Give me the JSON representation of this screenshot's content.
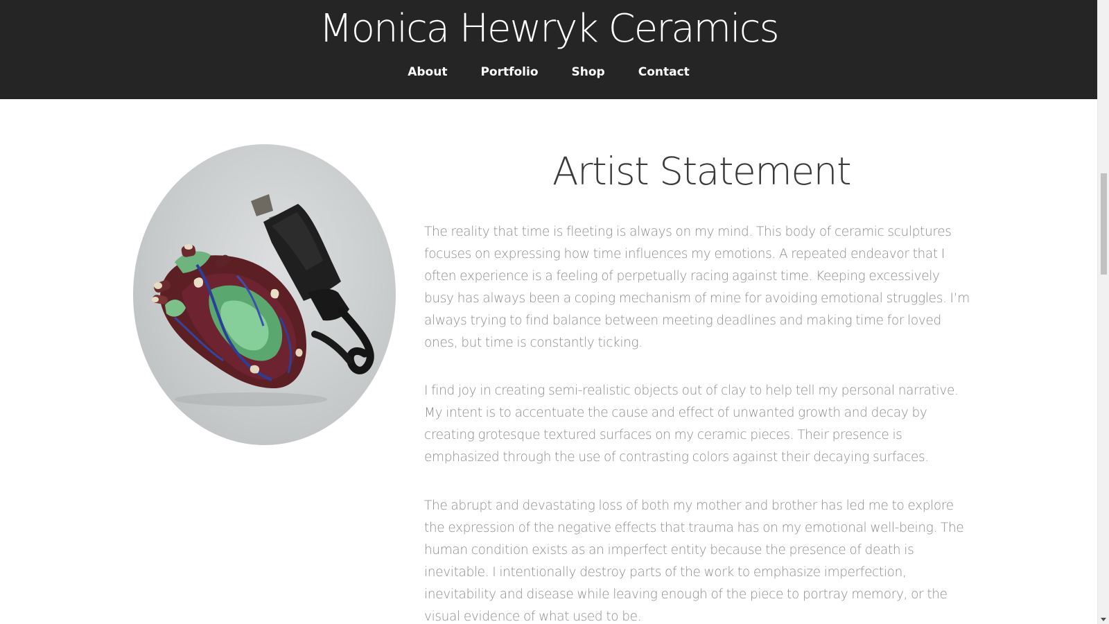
{
  "header": {
    "site_title": "Monica Hewryk Ceramics",
    "nav": [
      {
        "label": "About"
      },
      {
        "label": "Portfolio"
      },
      {
        "label": "Shop"
      },
      {
        "label": "Contact"
      }
    ]
  },
  "main": {
    "image_alt": "ceramic heart sculpture with electrical plug",
    "title": "Artist Statement",
    "paragraphs": [
      "The reality that time is fleeting is always on my mind. This body of ceramic sculptures focuses on expressing how time influences my emotions. A repeated endeavor that I often experience is a feeling of perpetually racing against time. Keeping excessively busy has always been a coping mechanism of mine for avoiding emotional struggles. I’m always trying to find balance between meeting deadlines and making time for loved ones, but time is constantly ticking.",
      "I find joy in creating semi-realistic objects out of clay to help tell my personal narrative. My intent is to accentuate the cause and effect of unwanted growth and decay by creating grotesque textured surfaces on my ceramic pieces. Their presence is emphasized through the use of contrasting colors against their decaying surfaces.",
      "The abrupt and devastating loss of both my mother and brother has led me to explore the expression of the negative effects that trauma has on my emotional well-being. The human condition exists as an imperfect entity because the presence of death is inevitable. I intentionally destroy parts of the work to emphasize imperfection, inevitability and disease while leaving enough of the piece to portray memory, or the visual evidence of what used to be."
    ]
  },
  "colors": {
    "header_bg": "#252525",
    "header_text": "#ffffff",
    "title_text": "#3a3a3a",
    "body_text": "#8c8c8c",
    "page_bg": "#ffffff"
  }
}
